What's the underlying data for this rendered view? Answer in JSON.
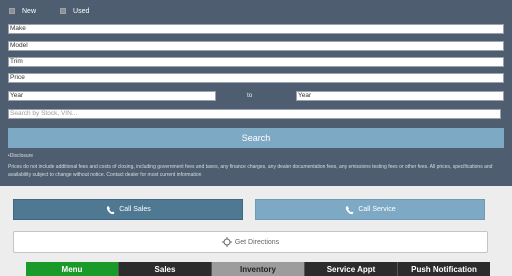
{
  "condition": {
    "options": [
      {
        "label": "New"
      },
      {
        "label": "Used"
      }
    ]
  },
  "filters": {
    "make": "Make",
    "model": "Model",
    "trim": "Trim",
    "price": "Price",
    "year_from": "Year",
    "year_to_separator": "to",
    "year_to": "Year",
    "search_placeholder": "Search by Stock, VIN..."
  },
  "search_button": "Search",
  "disclosure": {
    "title": "•Disclosure",
    "text": "Prices do not include additional fees and costs of closing, including government fees and taxes, any finance charges, any dealer documentation fees, any emissions testing fees or other fees. All prices, specifications and availability subject to change without notice. Contact dealer for most current information"
  },
  "actions": {
    "call_sales": "Call Sales",
    "call_service": "Call Service",
    "get_directions": "Get Directions"
  },
  "nav": {
    "menu": "Menu",
    "sales": "Sales",
    "inventory": "Inventory",
    "service_appt": "Service Appt",
    "push_notification": "Push Notification"
  },
  "colors": {
    "header_bg": "#4e5e70",
    "search_button": "#7ea9c4",
    "call_sales": "#4f7893",
    "nav_active": "#1a9a28",
    "nav_bg": "#2c2c2c"
  }
}
